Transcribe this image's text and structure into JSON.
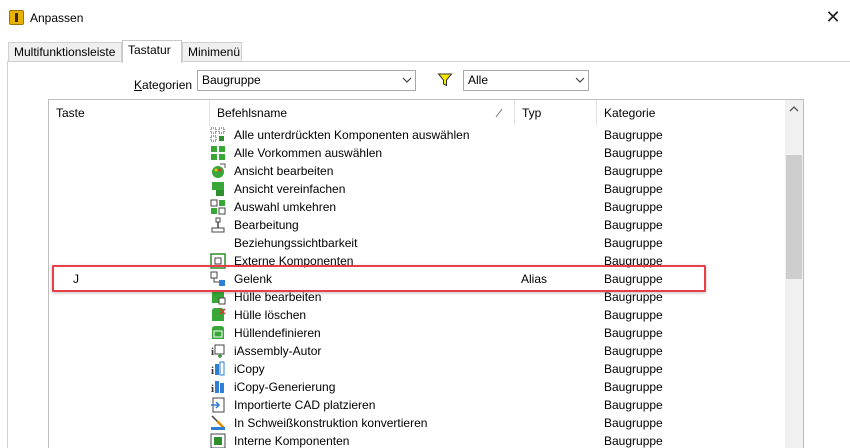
{
  "window": {
    "title": "Anpassen",
    "close_glyph": "✕"
  },
  "tabs": [
    {
      "label": "Multifunktionsleiste"
    },
    {
      "label": "Tastatur"
    },
    {
      "label": "Minimenü"
    }
  ],
  "filter": {
    "category_label_accel": "K",
    "category_label_rest": "ategorien",
    "category_value": "Baugruppe",
    "type_value": "Alle"
  },
  "columns": [
    "Taste",
    "Befehlsname",
    "Typ",
    "Kategorie"
  ],
  "rows": [
    {
      "key": "",
      "name": "Alle unterdrückten Komponenten auswählen",
      "type": "",
      "category": "Baugruppe",
      "icon": "select-suppressed-icon"
    },
    {
      "key": "",
      "name": "Alle Vorkommen auswählen",
      "type": "",
      "category": "Baugruppe",
      "icon": "select-all-occurrences-icon"
    },
    {
      "key": "",
      "name": "Ansicht bearbeiten",
      "type": "",
      "category": "Baugruppe",
      "icon": "edit-view-icon"
    },
    {
      "key": "",
      "name": "Ansicht vereinfachen",
      "type": "",
      "category": "Baugruppe",
      "icon": "simplify-view-icon"
    },
    {
      "key": "",
      "name": "Auswahl umkehren",
      "type": "",
      "category": "Baugruppe",
      "icon": "invert-selection-icon"
    },
    {
      "key": "",
      "name": "Bearbeitung",
      "type": "",
      "category": "Baugruppe",
      "icon": "machining-icon"
    },
    {
      "key": "",
      "name": "Beziehungssichtbarkeit",
      "type": "",
      "category": "Baugruppe",
      "icon": ""
    },
    {
      "key": "",
      "name": "Externe Komponenten",
      "type": "",
      "category": "Baugruppe",
      "icon": "external-components-icon"
    },
    {
      "key": "J",
      "name": "Gelenk",
      "type": "Alias",
      "category": "Baugruppe",
      "icon": "joint-icon"
    },
    {
      "key": "",
      "name": "Hülle bearbeiten",
      "type": "",
      "category": "Baugruppe",
      "icon": "edit-envelope-icon"
    },
    {
      "key": "",
      "name": "Hülle löschen",
      "type": "",
      "category": "Baugruppe",
      "icon": "delete-envelope-icon"
    },
    {
      "key": "",
      "name": "Hüllendefinieren",
      "type": "",
      "category": "Baugruppe",
      "icon": "define-envelope-icon"
    },
    {
      "key": "",
      "name": "iAssembly-Autor",
      "type": "",
      "category": "Baugruppe",
      "icon": "iassembly-author-icon"
    },
    {
      "key": "",
      "name": "iCopy",
      "type": "",
      "category": "Baugruppe",
      "icon": "icopy-icon"
    },
    {
      "key": "",
      "name": "iCopy-Generierung",
      "type": "",
      "category": "Baugruppe",
      "icon": "icopy-generate-icon"
    },
    {
      "key": "",
      "name": "Importierte CAD platzieren",
      "type": "",
      "category": "Baugruppe",
      "icon": "place-imported-cad-icon"
    },
    {
      "key": "",
      "name": "In Schweißkonstruktion konvertieren",
      "type": "",
      "category": "Baugruppe",
      "icon": "convert-weldment-icon"
    },
    {
      "key": "",
      "name": "Interne Komponenten",
      "type": "",
      "category": "Baugruppe",
      "icon": "internal-components-icon"
    }
  ]
}
